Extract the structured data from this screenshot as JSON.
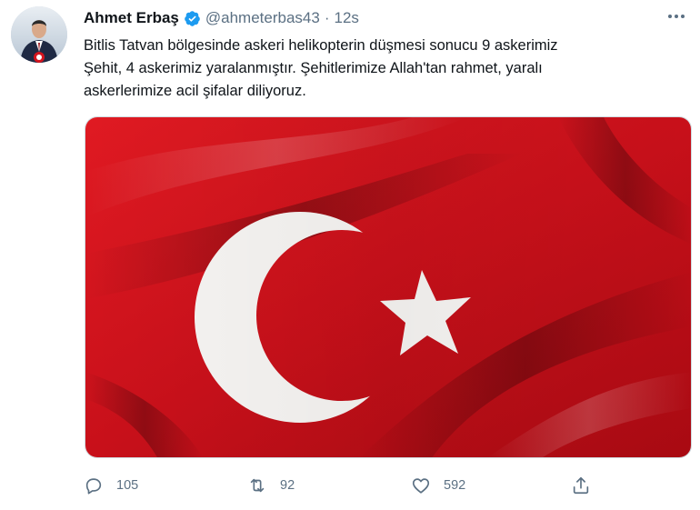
{
  "tweet": {
    "display_name": "Ahmet Erbaş",
    "handle": "@ahmeterbas43",
    "separator": "·",
    "time": "12s",
    "text": "Bitlis Tatvan bölgesinde askeri helikopterin düşmesi sonucu 9 askerimiz\nŞehit, 4 askerimiz yaralanmıştır. Şehitlerimize Allah'tan rahmet, yaralı\naskerlerimize acil şifalar diliyoruz.",
    "media_alt": "turkish-flag-image",
    "verified": true
  },
  "actions": {
    "reply_count": "105",
    "retweet_count": "92",
    "like_count": "592"
  },
  "icons": {
    "more": "more-dots-icon",
    "reply": "reply-icon",
    "retweet": "retweet-icon",
    "like": "heart-icon",
    "share": "share-icon",
    "verified": "verified-badge-icon"
  },
  "colors": {
    "accent": "#1d9bf0",
    "muted": "#5b7083",
    "flag_red": "#d4141e",
    "text": "#0f1419"
  }
}
